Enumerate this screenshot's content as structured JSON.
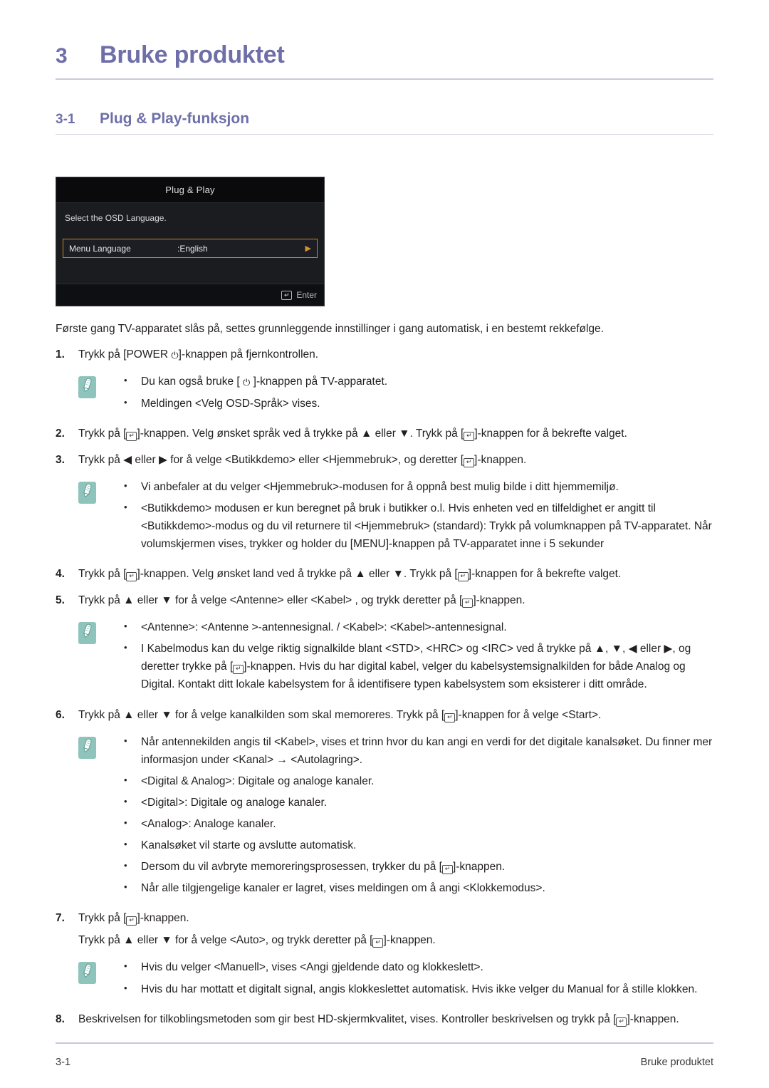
{
  "chapter": {
    "number": "3",
    "title": "Bruke produktet"
  },
  "section": {
    "number": "3-1",
    "title": "Plug & Play-funksjon"
  },
  "colors": {
    "heading": "#6e6fa8",
    "rule": "#c9c9d8",
    "note_icon_bg": "#8fc4bc",
    "osd_highlight_border": "#c08a2c",
    "osd_background": "#1b1c20"
  },
  "osd": {
    "title": "Plug & Play",
    "instruction": "Select the OSD Language.",
    "row_label": "Menu Language",
    "row_value": ":English",
    "row_arrow": "▶",
    "enter_label": "Enter",
    "enter_icon": "↵"
  },
  "intro": "Første gang TV-apparatet slås på, settes grunnleggende innstillinger i gang automatisk, i en bestemt rekkefølge.",
  "steps": {
    "s1": {
      "num": "1.",
      "a": "Trykk på [POWER ",
      "b": "]-knappen på fjernkontrollen."
    },
    "s2": {
      "num": "2.",
      "a": "Trykk på [",
      "b": "]-knappen. Velg ønsket språk ved å trykke på ▲ eller ▼. Trykk på [",
      "c": "]-knappen for å bekrefte valget."
    },
    "s3": {
      "num": "3.",
      "a": "Trykk på ◀ eller ▶ for å velge <Butikkdemo> eller <Hjemmebruk>, og deretter [",
      "b": "]-knappen."
    },
    "s4": {
      "num": "4.",
      "a": "Trykk på [",
      "b": "]-knappen. Velg ønsket land ved å trykke på ▲ eller ▼. Trykk på [",
      "c": "]-knappen for å bekrefte valget."
    },
    "s5": {
      "num": "5.",
      "a": "Trykk på ▲ eller ▼ for å velge <Antenne> eller <Kabel> , og trykk deretter på [",
      "b": "]-knappen."
    },
    "s6": {
      "num": "6.",
      "a": "Trykk på ▲ eller ▼ for å velge kanalkilden som skal memoreres. Trykk på [",
      "b": "]-knappen for å velge <Start>."
    },
    "s7": {
      "num": "7.",
      "a": "Trykk på [",
      "b": "]-knappen.",
      "sub_a": "Trykk på ▲ eller ▼ for å velge <Auto>, og trykk deretter på [",
      "sub_b": "]-knappen."
    },
    "s8": {
      "num": "8.",
      "a": "Beskrivelsen for tilkoblingsmetoden som gir best HD-skjermkvalitet, vises. Kontroller beskrivelsen og trykk på [",
      "b": "]-knappen."
    }
  },
  "notes": {
    "n1": {
      "items": [
        {
          "a": "Du kan også bruke [ ",
          "b": " ]-knappen på TV-apparatet."
        },
        {
          "a": "Meldingen <Velg OSD-Språk> vises.",
          "b": ""
        }
      ]
    },
    "n2": {
      "items": [
        {
          "text": "Vi anbefaler at du velger <Hjemmebruk>-modusen for å oppnå best mulig bilde i ditt hjemmemiljø."
        },
        {
          "text": "<Butikkdemo> modusen er kun beregnet på bruk i butikker o.l. Hvis enheten ved en tilfeldighet er angitt til <Butikkdemo>-modus og du vil returnere til <Hjemmebruk> (standard): Trykk på volumknappen på TV-apparatet. Når volumskjermen vises, trykker og holder du [MENU]-knappen på TV-apparatet inne i 5 sekunder"
        }
      ]
    },
    "n3": {
      "item1": "<Antenne>: <Antenne >-antennesignal. / <Kabel>: <Kabel>-antennesignal.",
      "item2_a": "I Kabelmodus kan du velge riktig signalkilde blant <STD>, <HRC> og <IRC> ved å trykke på ▲, ▼, ◀ eller ▶, og deretter trykke på [",
      "item2_b": "]-knappen. Hvis du har digital kabel, velger du kabelsystemsignalkilden for både Analog og Digital. Kontakt ditt lokale kabelsystem for å identifisere typen kabelsystem som eksisterer i ditt område."
    },
    "n4": {
      "item1": "Når antennekilden angis til <Kabel>, vises et trinn hvor du kan angi en verdi for det digitale kanalsøket. Du finner mer informasjon under <Kanal> → <Autolagring>.",
      "item2": "<Digital & Analog>: Digitale og analoge kanaler.",
      "item3": "<Digital>: Digitale og analoge kanaler.",
      "item4": "<Analog>: Analoge kanaler.",
      "item5": "Kanalsøket vil starte og avslutte automatisk.",
      "item6_a": "Dersom du vil avbryte memoreringsprosessen, trykker du på [",
      "item6_b": "]-knappen.",
      "item7": "Når alle tilgjengelige kanaler er lagret, vises meldingen om å angi <Klokkemodus>."
    },
    "n5": {
      "item1": "Hvis du velger <Manuell>, vises <Angi gjeldende dato og klokkeslett>.",
      "item2": "Hvis du har mottatt et digitalt signal, angis klokkeslettet automatisk. Hvis ikke velger du Manual for å stille klokken."
    }
  },
  "footer": {
    "left": "3-1",
    "right": "Bruke produktet"
  },
  "glyphs": {
    "bullet": "•",
    "enter_key": "↵",
    "power": "⏻"
  }
}
